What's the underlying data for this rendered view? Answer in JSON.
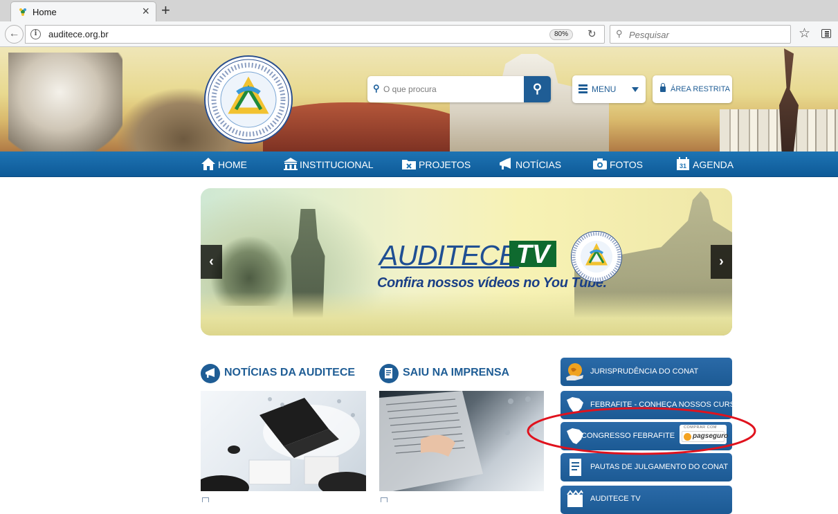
{
  "browser": {
    "tab_title": "Home",
    "tab_close": "×",
    "new_tab": "+",
    "back": "←",
    "url": "auditece.org.br",
    "zoom": "80%",
    "reload": "↻",
    "search_placeholder": "Pesquisar",
    "search_icon": "⚲",
    "bookmark_star": "☆"
  },
  "header": {
    "search_placeholder": "O que procura",
    "search_icon": "⚲",
    "menu_label": "MENU",
    "restricted_label": "ÁREA RESTRITA",
    "colors": {
      "brand_blue": "#1f5d95",
      "nav_blue": "#1e74b3",
      "green": "#0f6a2f"
    }
  },
  "nav": {
    "items": [
      {
        "label": "HOME",
        "icon": "home-icon"
      },
      {
        "label": "INSTITUCIONAL",
        "icon": "building-icon"
      },
      {
        "label": "PROJETOS",
        "icon": "folder-icon"
      },
      {
        "label": "NOTÍCIAS",
        "icon": "megaphone-icon"
      },
      {
        "label": "FOTOS",
        "icon": "camera-icon"
      },
      {
        "label": "AGENDA",
        "icon": "calendar-icon"
      }
    ]
  },
  "slider": {
    "title_a": "AUDITECE",
    "title_b": "TV",
    "subtitle": "Confira nossos vídeos no You Tube.",
    "prev": "‹",
    "next": "›"
  },
  "sections": {
    "news_title": "NOTÍCIAS DA AUDITECE",
    "press_title": "SAIU NA IMPRENSA"
  },
  "sidebar": {
    "items": [
      {
        "label": "JURISPRUDÊNCIA DO CONAT",
        "icon": "globe-hand-icon"
      },
      {
        "label": "FEBRAFITE - CONHEÇA NOSSOS CURSOS",
        "icon": "brazil-map-icon"
      },
      {
        "label": "CONGRESSO FEBRAFITE",
        "icon": "brazil-map-icon"
      },
      {
        "label": "PAUTAS DE JULGAMENTO DO CONAT",
        "icon": "document-icon"
      },
      {
        "label": "AUDITECE TV",
        "icon": "film-icon"
      }
    ],
    "pagseguro_top": "COMPRAR COM",
    "pagseguro_text": "pagseguro"
  }
}
